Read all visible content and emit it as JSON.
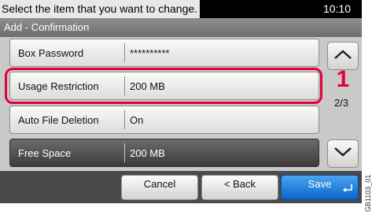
{
  "header": {
    "instruction": "Select the item that you want to change.",
    "time": "10:10",
    "subtitle": "Add - Confirmation"
  },
  "rows": [
    {
      "label": "Box Password",
      "value": "**********"
    },
    {
      "label": "Usage Restriction",
      "value": "200 MB"
    },
    {
      "label": "Auto File Deletion",
      "value": "On"
    },
    {
      "label": "Free Space",
      "value": "200 MB"
    }
  ],
  "annotation": {
    "step": "1"
  },
  "pagination": {
    "indicator": "2/3",
    "up_icon": "chevron-up-icon",
    "down_icon": "chevron-down-icon"
  },
  "buttons": {
    "cancel": "Cancel",
    "back": "< Back",
    "save": "Save",
    "save_icon": "enter-arrow-icon"
  },
  "figure_code": "GB1103_01",
  "colors": {
    "highlight": "#e4003a",
    "save_button": "#1a7de0",
    "dark_row": "#4a4a4a"
  }
}
